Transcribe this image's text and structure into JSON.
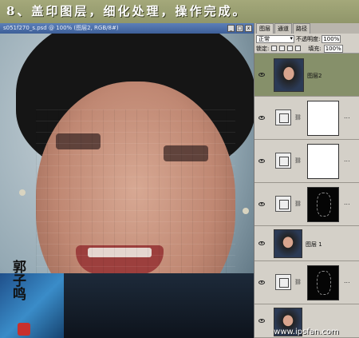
{
  "banner": {
    "step_text": "8、盖印图层，细化处理，操作完成。"
  },
  "document": {
    "title": "s051f270_s.psd @ 100% (图层2, RGB/8#)",
    "controls": [
      "_",
      "□",
      "x"
    ]
  },
  "canvas": {
    "signature_text": "郭子鸣"
  },
  "layers_panel": {
    "tabs": [
      {
        "label": "图层",
        "active": true
      },
      {
        "label": "通道",
        "active": false
      },
      {
        "label": "路径",
        "active": false
      }
    ],
    "blend_mode": "正常",
    "opacity_label": "不透明度:",
    "opacity_value": "100%",
    "lock_label": "锁定:",
    "fill_label": "填充:",
    "fill_value": "100%",
    "layers": [
      {
        "name": "图层2",
        "thumb": "photo",
        "selected": true
      },
      {
        "name": "",
        "thumb": "white",
        "adjustment": true,
        "dots": "..."
      },
      {
        "name": "",
        "thumb": "white",
        "adjustment": true,
        "dots": "..."
      },
      {
        "name": "",
        "thumb": "black",
        "adjustment": true,
        "dots": "..."
      },
      {
        "name": "图层 1",
        "thumb": "photo",
        "selected": false
      },
      {
        "name": "",
        "thumb": "black",
        "adjustment": true,
        "dots": "..."
      },
      {
        "name": "",
        "thumb": "photo",
        "selected": false
      }
    ]
  },
  "watermark": "www.ipsfan.com"
}
